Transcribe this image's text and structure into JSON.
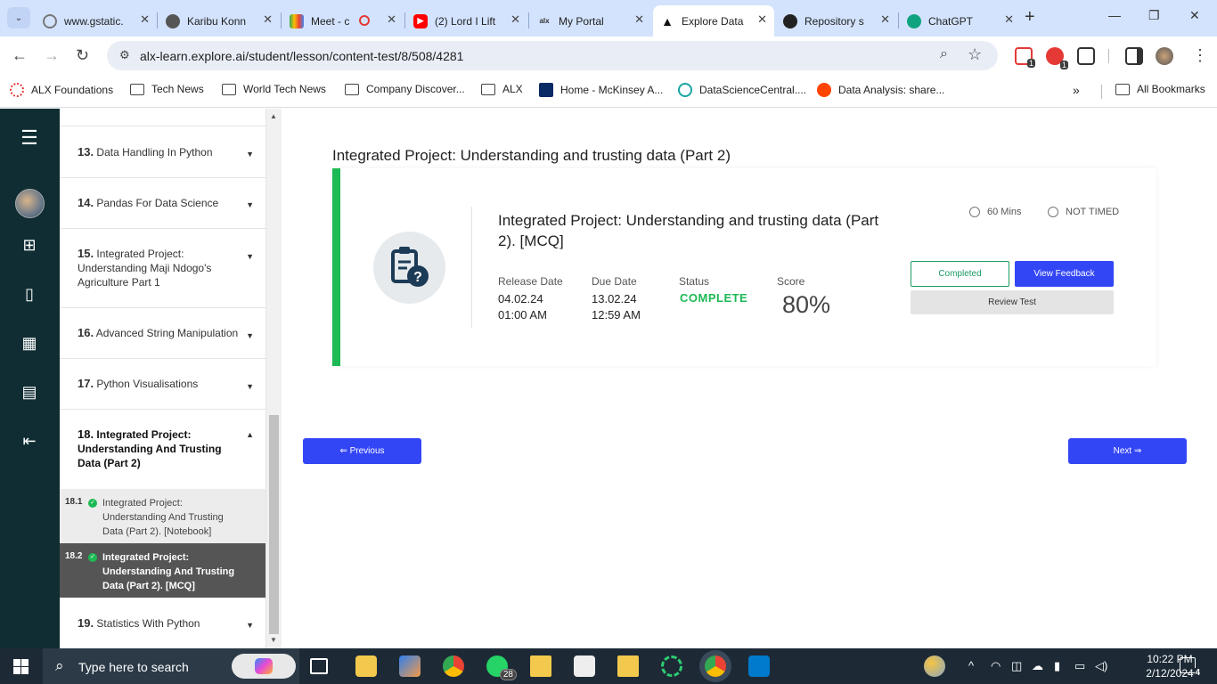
{
  "browser": {
    "tabs": [
      {
        "title": "www.gstatic.",
        "active": false
      },
      {
        "title": "Karibu Konn",
        "active": false
      },
      {
        "title": "Meet - c",
        "active": false
      },
      {
        "title": "(2) Lord I Lift",
        "active": false
      },
      {
        "title": "My Portal",
        "active": false
      },
      {
        "title": "Explore Data",
        "active": true
      },
      {
        "title": "Repository s",
        "active": false
      },
      {
        "title": "ChatGPT",
        "active": false
      }
    ],
    "url": "alx-learn.explore.ai/student/lesson/content-test/8/508/4281",
    "extensions": [
      {
        "badge": "1"
      },
      {
        "badge": "1"
      }
    ],
    "bookmarks": [
      {
        "label": "ALX Foundations"
      },
      {
        "label": "Tech News"
      },
      {
        "label": "World Tech News"
      },
      {
        "label": "Company Discover..."
      },
      {
        "label": "ALX"
      },
      {
        "label": "Home - McKinsey A..."
      },
      {
        "label": "DataScienceCentral...."
      },
      {
        "label": "Data Analysis: share..."
      }
    ],
    "all_bookmarks": "All Bookmarks"
  },
  "sidebar": {
    "sections": [
      {
        "num": "13.",
        "title": "Data Handling In Python"
      },
      {
        "num": "14.",
        "title": "Pandas For Data Science"
      },
      {
        "num": "15.",
        "title": "Integrated Project: Understanding Maji Ndogo's Agriculture Part 1"
      },
      {
        "num": "16.",
        "title": "Advanced String Manipulation"
      },
      {
        "num": "17.",
        "title": "Python Visualisations"
      },
      {
        "num": "18.",
        "title": "Integrated Project: Understanding And Trusting Data (Part 2)"
      },
      {
        "num": "19.",
        "title": "Statistics With Python"
      }
    ],
    "subitems": [
      {
        "num": "18.1",
        "title": "Integrated Project: Understanding And Trusting Data (Part 2). [Notebook]"
      },
      {
        "num": "18.2",
        "title": "Integrated Project: Understanding And Trusting Data (Part 2). [MCQ]"
      }
    ]
  },
  "main": {
    "lesson_title": "Integrated Project: Understanding and trusting data (Part 2)",
    "card": {
      "title": "Integrated Project: Understanding and trusting data (Part 2). [MCQ]",
      "duration": "60 Mins",
      "timing": "NOT TIMED",
      "release_label": "Release Date",
      "release_date": "04.02.24",
      "release_time": "01:00 AM",
      "due_label": "Due Date",
      "due_date": "13.02.24",
      "due_time": "12:59 AM",
      "status_label": "Status",
      "status_value": "COMPLETE",
      "score_label": "Score",
      "score_value": "80%",
      "completed_btn": "Completed",
      "feedback_btn": "View Feedback",
      "review_btn": "Review Test"
    },
    "prev_btn": "⇐ Previous",
    "next_btn": "Next ⇒"
  },
  "taskbar": {
    "search_placeholder": "Type here to search",
    "whatsapp_badge": "28",
    "time": "10:22 PM",
    "date": "2/12/2024",
    "notifications": "4"
  },
  "colors": {
    "accent_green": "#1db954",
    "button_blue": "#3346f6",
    "rail_bg": "#0f2d33"
  }
}
